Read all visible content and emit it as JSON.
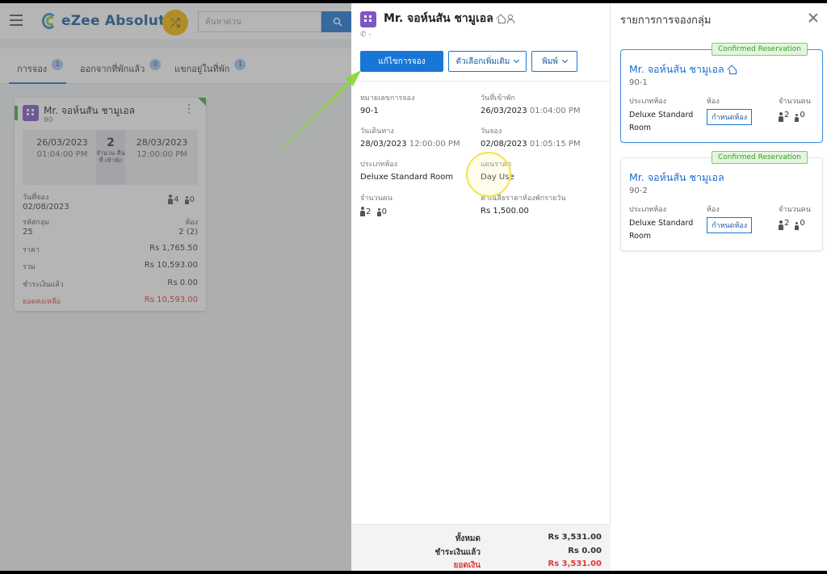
{
  "app": {
    "name": "eZee Absolute",
    "search_placeholder": "ค้นหาด่วน"
  },
  "tabs": [
    {
      "label": "การจอง",
      "count": "1"
    },
    {
      "label": "ออกจากที่พักแล้ว",
      "count": "0"
    },
    {
      "label": "แขกอยู่ในที่พัก",
      "count": "1"
    }
  ],
  "booking_card": {
    "guest_name": "Mr. จอห์นสัน ชามูเอล",
    "id": "90",
    "arrival_date": "26/03/2023",
    "arrival_time": "01:04:00 PM",
    "nights": "2",
    "nights_label": "จำนวน คืนที่ เข้าพัก",
    "departure_date": "28/03/2023",
    "departure_time": "12:00:00 PM",
    "booking_date_label": "วันที่จอง",
    "booking_date": "02/08/2023",
    "adults": "4",
    "children": "0",
    "group_code_label": "รหัสกลุ่ม",
    "group_code": "25",
    "rooms_label": "ห้อง",
    "rooms": "2 (2)",
    "price_label": "ราคา",
    "price": "Rs 1,765.50",
    "total_label": "รวม",
    "total": "Rs 10,593.00",
    "paid_label": "ชำระเงินแล้ว",
    "paid": "Rs 0.00",
    "balance_label": "ยอดคงเหลือ",
    "balance": "Rs 10,593.00"
  },
  "detail": {
    "guest_name": "Mr. จอห์นสัน ชามูเอล",
    "phone": "-",
    "edit_button": "แก้ไขการจอง",
    "more_options_button": "ตัวเลือกเพิ่มเติม",
    "print_button": "พิมพ์",
    "reservation_no_label": "หมายเลขการจอง",
    "reservation_no": "90-1",
    "arrival_label": "วันที่เข้าพัก",
    "arrival_date": "26/03/2023",
    "arrival_time": "01:04:00 PM",
    "departure_label": "วันเดินทาง",
    "departure_date": "28/03/2023",
    "departure_time": "12:00:00 PM",
    "booking_label": "วันจอง",
    "booking_date": "02/08/2023",
    "booking_time": "01:05:15 PM",
    "room_type_label": "ประเภทห้อง",
    "room_type": "Deluxe Standard Room",
    "rate_plan_label": "แผนราคา",
    "rate_plan": "Day Use",
    "pax_label": "จำนวนคน",
    "adults": "2",
    "children": "0",
    "avg_rate_label": "ค่าเฉลี่ยราคาห้องพักรายวัน",
    "avg_rate": "Rs 1,500.00",
    "totals": {
      "total_label": "ทั้งหมด",
      "total": "Rs 3,531.00",
      "paid_label": "ชำระเงินแล้ว",
      "paid": "Rs 0.00",
      "balance_label": "ยอดเงิน",
      "balance": "Rs 3,531.00"
    }
  },
  "group_list": {
    "title": "รายการการจองกลุ่ม",
    "items": [
      {
        "status": "Confirmed Reservation",
        "guest_name": "Mr. จอห์นสัน ชามูเอล",
        "id": "90-1",
        "room_type_label": "ประเภทห้อง",
        "room_type_1": "Deluxe Standard",
        "room_type_2": "Room",
        "room_label": "ห้อง",
        "assign_button": "กำหนดห้อง",
        "pax_label": "จำนวนคน",
        "adults": "2",
        "children": "0"
      },
      {
        "status": "Confirmed Reservation",
        "guest_name": "Mr. จอห์นสัน ชามูเอล",
        "id": "90-2",
        "room_type_label": "ประเภทห้อง",
        "room_type_1": "Deluxe Standard",
        "room_type_2": "Room",
        "room_label": "ห้อง",
        "assign_button": "กำหนดห้อง",
        "pax_label": "จำนวนคน",
        "adults": "2",
        "children": "0"
      }
    ]
  },
  "colors": {
    "primary": "#1877d6",
    "link": "#1a6ccf",
    "confirmed": "#3a9a2a",
    "danger": "#e53935",
    "annotation_arrow": "#8cd43a",
    "annotation_circle": "#f0e54a"
  }
}
